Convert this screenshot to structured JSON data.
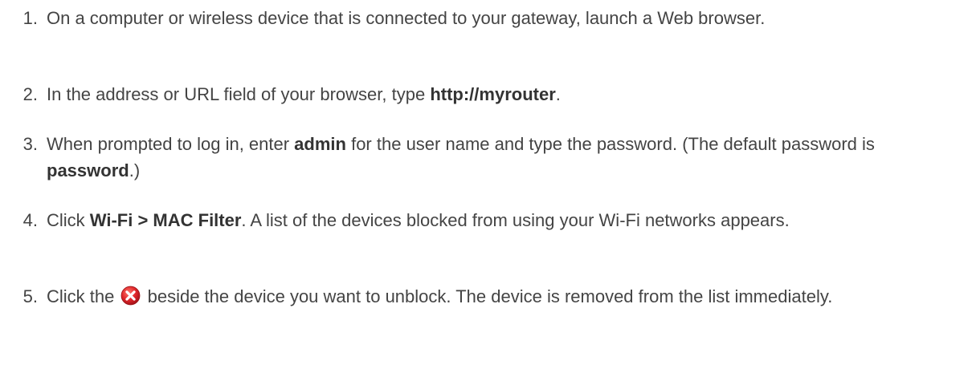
{
  "steps": [
    {
      "number": "1.",
      "parts": [
        {
          "text": "On a computer or wireless device that is connected to your gateway, launch a Web browser.",
          "bold": false
        }
      ]
    },
    {
      "number": "2.",
      "parts": [
        {
          "text": "In the address or URL field of your browser, type ",
          "bold": false
        },
        {
          "text": "http://myrouter",
          "bold": true
        },
        {
          "text": ".",
          "bold": false
        }
      ]
    },
    {
      "number": "3.",
      "parts": [
        {
          "text": "When prompted to log in, enter ",
          "bold": false
        },
        {
          "text": "admin",
          "bold": true
        },
        {
          "text": " for the user name and type the password. (The default password is ",
          "bold": false
        },
        {
          "text": "password",
          "bold": true
        },
        {
          "text": ".)",
          "bold": false
        }
      ]
    },
    {
      "number": "4.",
      "parts": [
        {
          "text": "Click ",
          "bold": false
        },
        {
          "text": "Wi-Fi > MAC Filter",
          "bold": true
        },
        {
          "text": ". A list of the devices blocked from using your Wi-Fi networks appears.",
          "bold": false
        }
      ]
    },
    {
      "number": "5.",
      "parts": [
        {
          "text": "Click the ",
          "bold": false
        },
        {
          "text": " beside the device you want to unblock. The device is removed from the list immediately.",
          "bold": false
        }
      ]
    }
  ],
  "icons": {
    "remove_icon": "red-circle-x-icon",
    "remove_color": "#e0262a"
  }
}
